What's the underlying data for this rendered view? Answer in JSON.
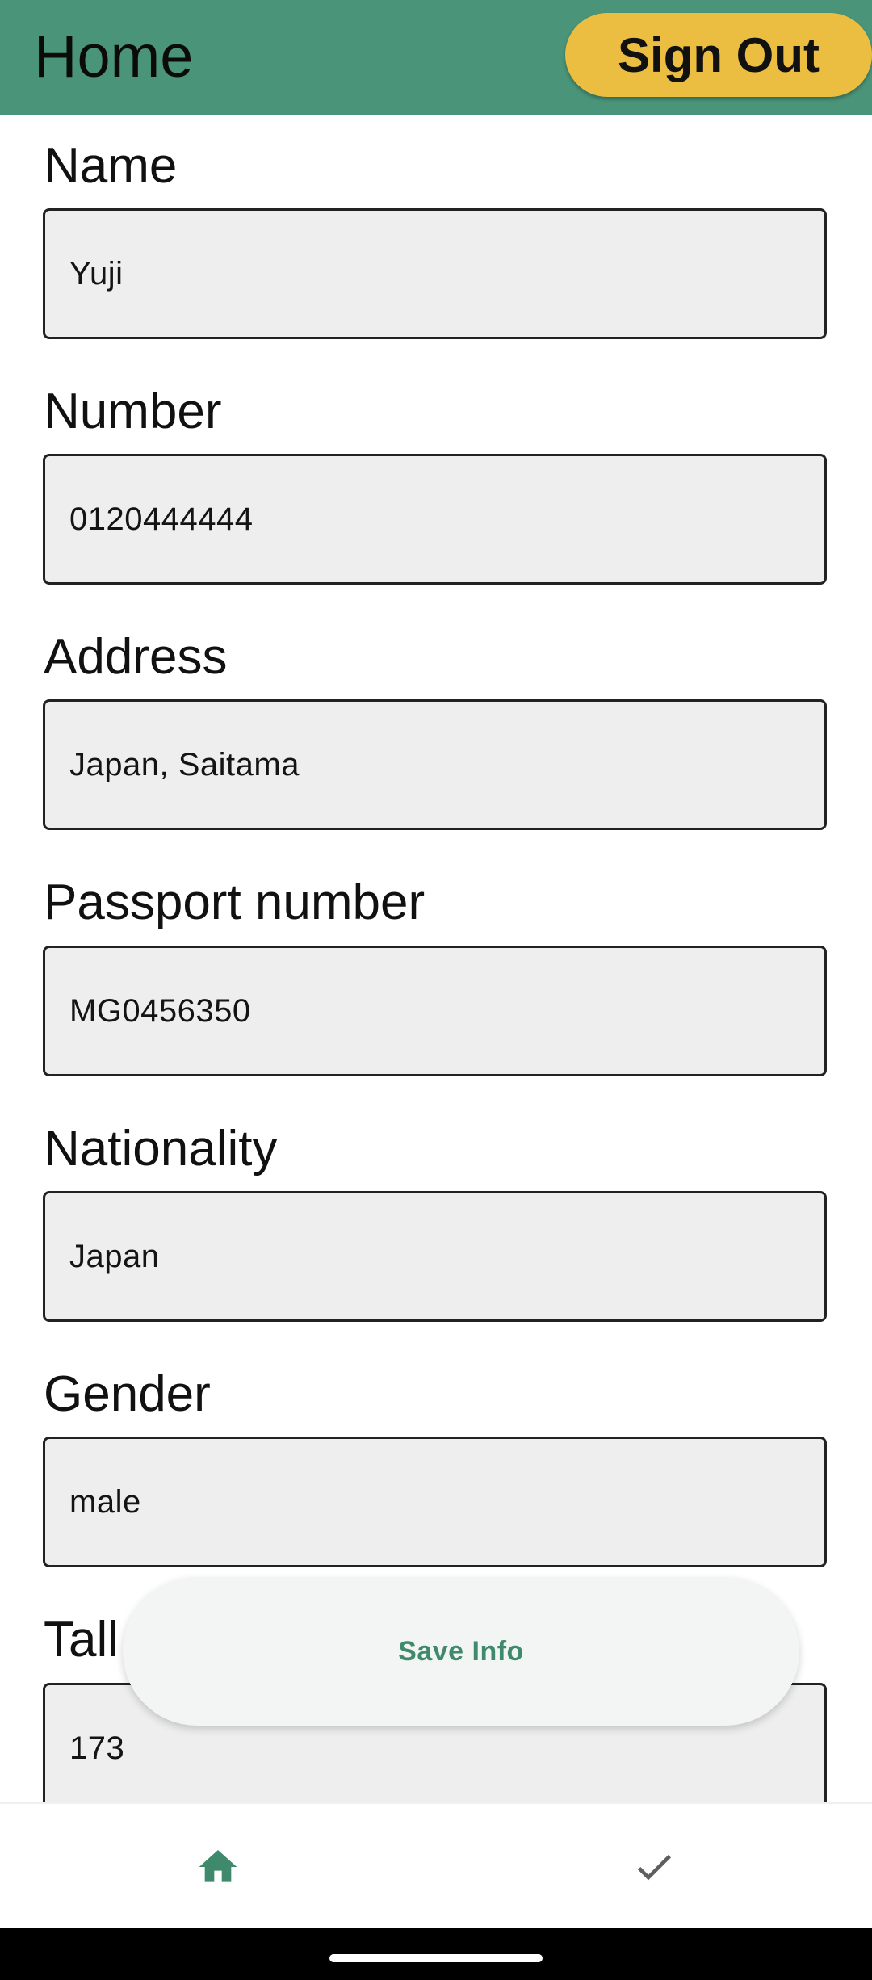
{
  "appbar": {
    "title": "Home",
    "sign_out_label": "Sign Out"
  },
  "form": {
    "fields": [
      {
        "label": "Name",
        "value": "Yuji"
      },
      {
        "label": "Number",
        "value": "0120444444"
      },
      {
        "label": "Address",
        "value": "Japan, Saitama"
      },
      {
        "label": "Passport number",
        "value": "MG0456350"
      },
      {
        "label": "Nationality",
        "value": "Japan"
      },
      {
        "label": "Gender",
        "value": "male"
      },
      {
        "label": "Tall",
        "value": "173"
      }
    ]
  },
  "snackbar": {
    "label": "Save Info"
  },
  "bottom_nav": {
    "items": [
      {
        "icon": "home-icon",
        "selected": true
      },
      {
        "icon": "check-icon",
        "selected": false
      }
    ]
  },
  "colors": {
    "appbar": "#4a9479",
    "accent": "#3f8a6c",
    "sign_out_button": "#ebbd40",
    "field_background": "#eeeeee"
  }
}
